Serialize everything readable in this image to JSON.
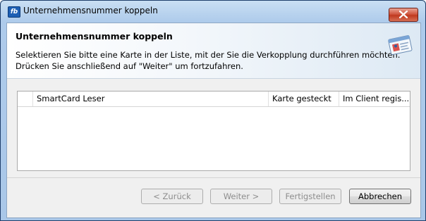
{
  "window": {
    "title": "Unternehmensnummer koppeln",
    "app_icon": "fb-app-icon"
  },
  "header": {
    "title": "Unternehmensnummer koppeln",
    "lines": [
      "Selektieren Sie bitte eine Karte in der Liste, mit der Sie die Verkopplung durchführen möchten.",
      "Drücken Sie anschließend auf \"Weiter\" um fortzufahren."
    ]
  },
  "list": {
    "columns": [
      "",
      "SmartCard Leser",
      "Karte gesteckt",
      "Im Client regis..."
    ],
    "rows": []
  },
  "buttons": {
    "back": "< Zurück",
    "next": "Weiter >",
    "finish": "Fertigstellen",
    "cancel": "Abbrechen"
  }
}
